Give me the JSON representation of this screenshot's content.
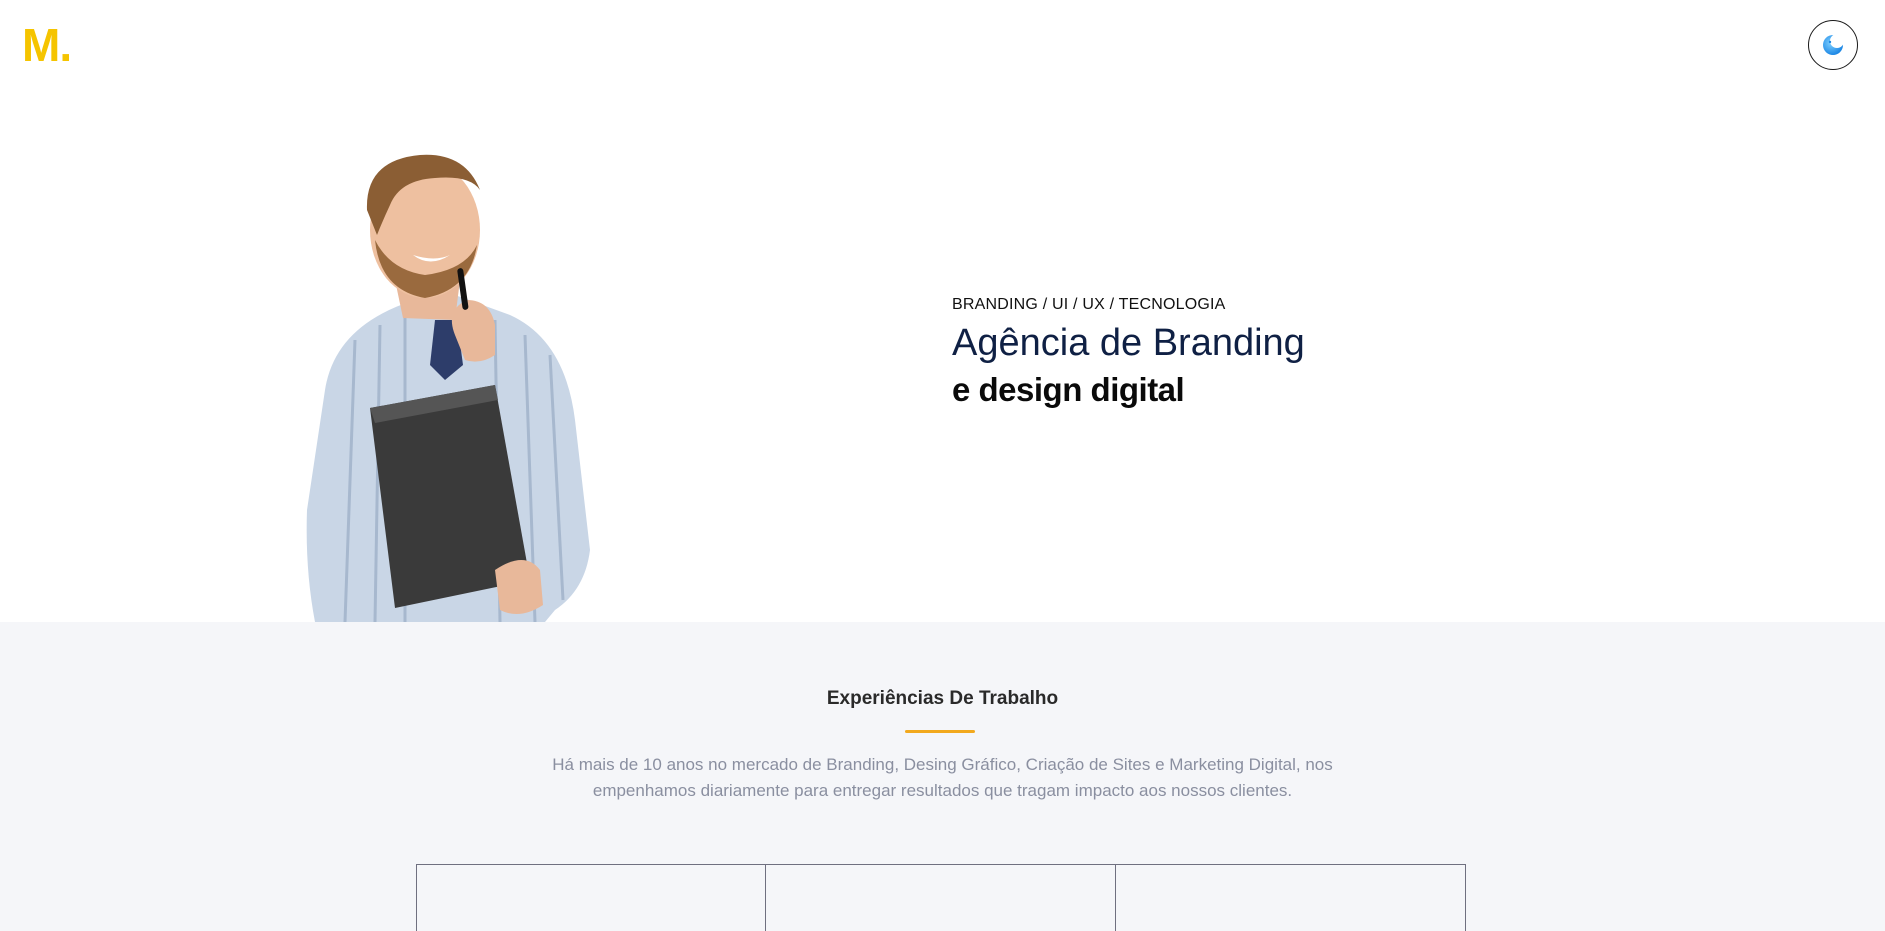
{
  "header": {
    "logo_text": "M.",
    "theme_toggle_icon": "moon-icon",
    "accent_color": "#f5c400"
  },
  "hero": {
    "eyebrow": "BRANDING / UI / UX / TECNOLOGIA",
    "headline_line1": "Agência de Branding",
    "headline_line2": "e design digital",
    "image_icon": "person-holding-folder-photo"
  },
  "experience": {
    "title": "Experiências De Trabalho",
    "underline_color": "#f2a91e",
    "description": "Há mais de 10 anos no mercado de Branding, Desing Gráfico, Criação de Sites e Marketing Digital, nos empenhamos diariamente para entregar resultados que tragam impacto aos nossos clientes.",
    "card_count": 3
  }
}
